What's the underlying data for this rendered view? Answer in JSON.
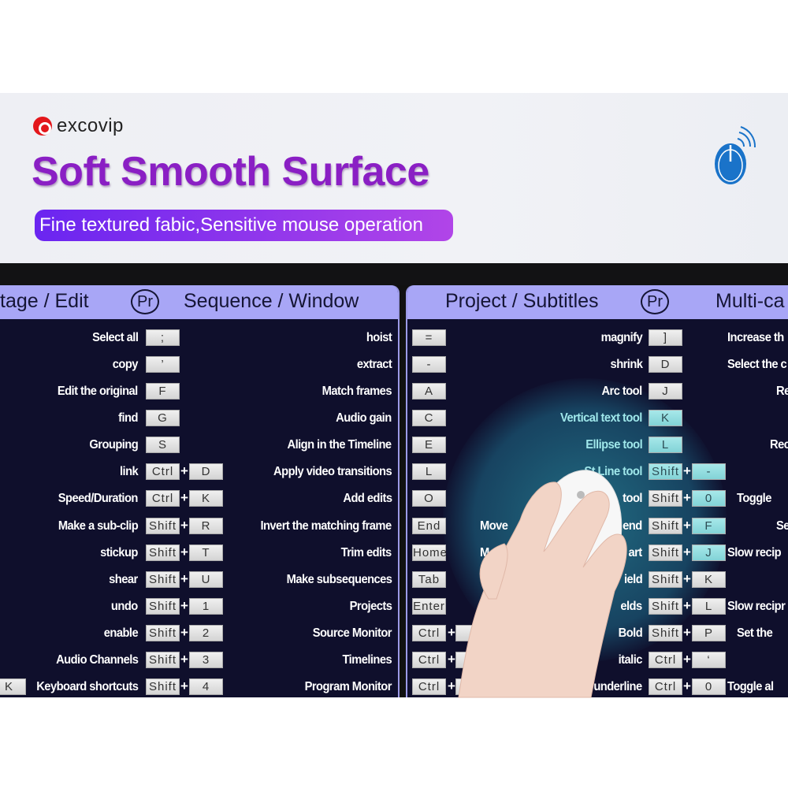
{
  "brand": {
    "name": "excovip",
    "color": "#e3161b"
  },
  "headline": "Soft Smooth Surface",
  "tagline": "Fine textured fabic,Sensitive mouse operation",
  "colors": {
    "headline": "#8a1fc4",
    "panel_header": "#a8a6f6",
    "panel_bg": "#0f0f2c",
    "highlight": "#9fe7ea"
  },
  "icons": {
    "top_right": "wireless-mouse-icon",
    "panel_badge": "premiere-pro-icon"
  },
  "panel_left": {
    "title_left": "tage / Edit",
    "badge": "Pr",
    "title_right": "Sequence / Window",
    "edge_key": "K",
    "col1": [
      {
        "label": "Select all",
        "keys": [
          ";"
        ]
      },
      {
        "label": "copy",
        "keys": [
          "’"
        ]
      },
      {
        "label": "Edit the original",
        "keys": [
          "F"
        ]
      },
      {
        "label": "find",
        "keys": [
          "G"
        ]
      },
      {
        "label": "Grouping",
        "keys": [
          "S"
        ]
      },
      {
        "label": "link",
        "keys": [
          "Ctrl",
          "D"
        ]
      },
      {
        "label": "Speed/Duration",
        "keys": [
          "Ctrl",
          "K"
        ]
      },
      {
        "label": "Make a sub-clip",
        "keys": [
          "Shift",
          "R"
        ]
      },
      {
        "label": "stickup",
        "keys": [
          "Shift",
          "T"
        ]
      },
      {
        "label": "shear",
        "keys": [
          "Shift",
          "U"
        ]
      },
      {
        "label": "undo",
        "keys": [
          "Shift",
          "1"
        ]
      },
      {
        "label": "enable",
        "keys": [
          "Shift",
          "2"
        ]
      },
      {
        "label": "Audio Channels",
        "keys": [
          "Shift",
          "3"
        ]
      },
      {
        "label": "Keyboard shortcuts",
        "keys": [
          "Shift",
          "4"
        ]
      }
    ],
    "col2": [
      {
        "label": "hoist",
        "keys": []
      },
      {
        "label": "extract",
        "keys": []
      },
      {
        "label": "Match frames",
        "keys": []
      },
      {
        "label": "Audio gain",
        "keys": []
      },
      {
        "label": "Align in the Timeline",
        "keys": []
      },
      {
        "label": "Apply video transitions",
        "keys": []
      },
      {
        "label": "Add edits",
        "keys": []
      },
      {
        "label": "Invert the matching frame",
        "keys": []
      },
      {
        "label": "Trim edits",
        "keys": []
      },
      {
        "label": "Make subsequences",
        "keys": []
      },
      {
        "label": "Projects",
        "keys": []
      },
      {
        "label": "Source Monitor",
        "keys": []
      },
      {
        "label": "Timelines",
        "keys": []
      },
      {
        "label": "Program Monitor",
        "keys": []
      }
    ]
  },
  "panel_right": {
    "title_left": "Project / Subtitles",
    "badge": "Pr",
    "title_right": "Multi-ca",
    "col1": [
      {
        "label": "",
        "keys": [
          "="
        ]
      },
      {
        "label": "",
        "keys": [
          "-"
        ]
      },
      {
        "label": "",
        "keys": [
          "A"
        ]
      },
      {
        "label": "",
        "keys": [
          "C"
        ]
      },
      {
        "label": "",
        "keys": [
          "E"
        ]
      },
      {
        "label": "",
        "keys": [
          "L"
        ]
      },
      {
        "label": "",
        "keys": [
          "O"
        ]
      },
      {
        "label": "Move",
        "keys": [
          "End"
        ]
      },
      {
        "label": "M",
        "keys": [
          "Home"
        ]
      },
      {
        "label": "",
        "keys": [
          "Tab"
        ]
      },
      {
        "label": "",
        "keys": [
          "Enter"
        ]
      },
      {
        "label": "",
        "keys": [
          "Ctrl",
          ""
        ]
      },
      {
        "label": "",
        "keys": [
          "Ctrl",
          ""
        ]
      },
      {
        "label": "",
        "keys": [
          "Ctrl",
          ""
        ]
      }
    ],
    "col2": [
      {
        "label": "magnify",
        "keys": [
          "]"
        ]
      },
      {
        "label": "shrink",
        "keys": [
          "D"
        ]
      },
      {
        "label": "Arc tool",
        "keys": [
          "J"
        ]
      },
      {
        "label": "Vertical text tool",
        "keys": [
          "K"
        ],
        "hl": [
          true
        ]
      },
      {
        "label": "Ellipse tool",
        "keys": [
          "L"
        ],
        "hl": [
          true
        ]
      },
      {
        "label": "St     Line tool",
        "keys": [
          "Shift",
          "-"
        ],
        "hl": [
          true,
          true
        ]
      },
      {
        "label": "tool",
        "keys": [
          "Shift",
          "0"
        ],
        "hl": [
          false,
          true
        ]
      },
      {
        "label": "end",
        "keys": [
          "Shift",
          "F"
        ],
        "hl": [
          false,
          true
        ]
      },
      {
        "label": "art",
        "keys": [
          "Shift",
          "J"
        ],
        "hl": [
          false,
          true
        ]
      },
      {
        "label": "ield",
        "keys": [
          "Shift",
          "K"
        ]
      },
      {
        "label": "elds",
        "keys": [
          "Shift",
          "L"
        ]
      },
      {
        "label": "Bold",
        "keys": [
          "Shift",
          "P"
        ]
      },
      {
        "label": "italic",
        "keys": [
          "Ctrl",
          "‘"
        ]
      },
      {
        "label": "underline",
        "keys": [
          "Ctrl",
          "0"
        ]
      }
    ],
    "col3": [
      "Increase th",
      "Select the c",
      "Re",
      "",
      "Reci",
      "",
      "Toggle",
      "Se",
      "Slow recip",
      "",
      "Slow recipr",
      "Set the",
      "",
      "Toggle al"
    ]
  }
}
